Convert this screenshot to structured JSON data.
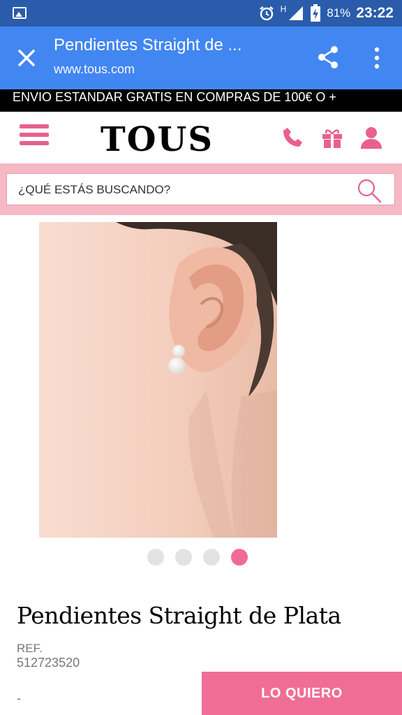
{
  "status_bar": {
    "network": "H",
    "battery_percent": "81%",
    "time": "23:22"
  },
  "browser": {
    "page_title": "Pendientes Straight de ...",
    "url": "www.tous.com"
  },
  "promo_banner": "ENVIO ESTANDAR GRATIS EN COMPRAS DE 100€ O +",
  "site": {
    "logo": "TOUS",
    "accent_color": "#f06d98"
  },
  "search": {
    "placeholder": "¿QUÉ ESTÁS BUSCANDO?"
  },
  "carousel": {
    "total": 4,
    "active_index": 3
  },
  "product": {
    "title": "Pendientes Straight de Plata",
    "ref_label": "REF.",
    "ref_value": "512723520",
    "price": "-",
    "buy_label": "LO QUIERO"
  }
}
